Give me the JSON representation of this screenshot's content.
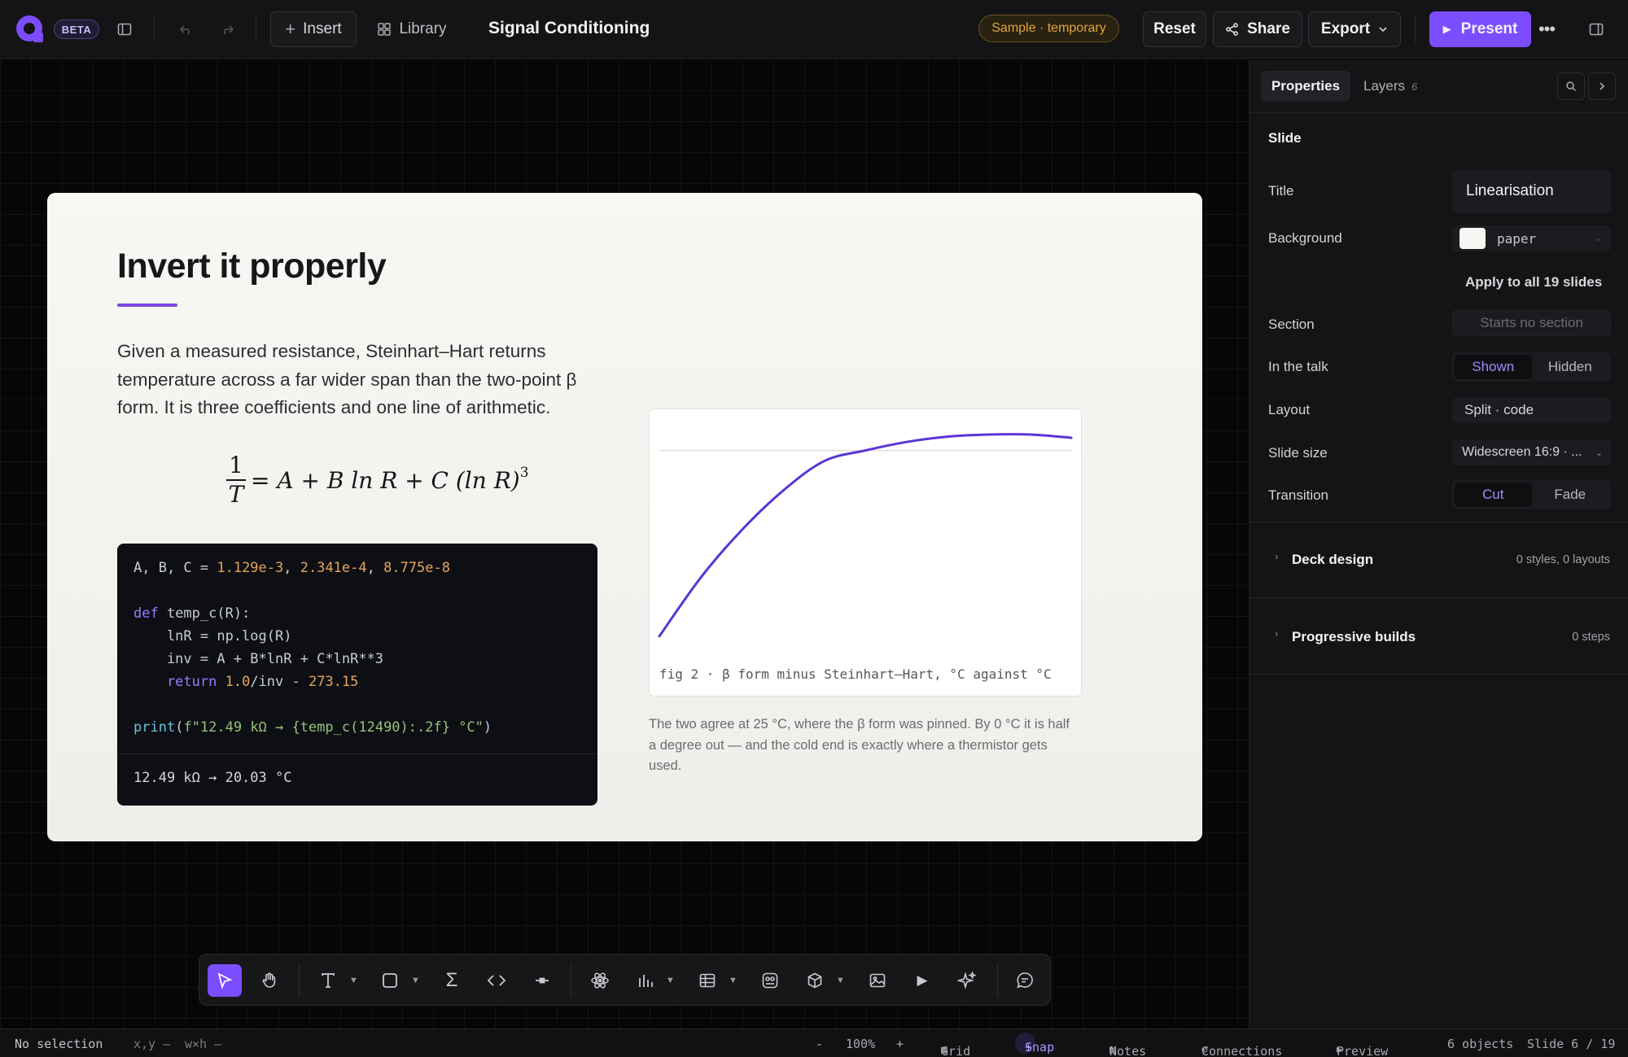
{
  "app": {
    "badge": "BETA",
    "doc_title": "Signal Conditioning",
    "sample_badge": "Sample · temporary"
  },
  "toolbar": {
    "insert": "Insert",
    "library": "Library",
    "reset": "Reset",
    "share": "Share",
    "export": "Export",
    "present": "Present"
  },
  "slide": {
    "title": "Invert it properly",
    "body": "Given a measured resistance, Steinhart–Hart returns temperature across a far wider span than the two-point β form. It is three coefficients and one line of arithmetic.",
    "formula": {
      "lhs_num": "1",
      "lhs_den": "T",
      "rhs": "= A + B ln R + C (ln R)",
      "exp": "3"
    },
    "code": {
      "l1_a": "A, B, C = ",
      "c1": "1.129e-3",
      "sep1": ", ",
      "c2": "2.341e-4",
      "sep2": ", ",
      "c3": "8.775e-8",
      "l2_kw": "def",
      "l2_rest": " temp_c(R):",
      "l3": "    lnR = np.log(R)",
      "l4": "    inv = A + B*lnR + C*lnR**3",
      "l5_kw": "    return",
      "l5_num": " 1.0",
      "l5_mid": "/inv - ",
      "l5_num2": "273.15",
      "l6_fn": "print",
      "l6_p": "(",
      "l6_str": "f\"12.49 kΩ → {temp_c(12490):.2f} °C\"",
      "l6_end": ")",
      "output": "12.49 kΩ → 20.03 °C"
    },
    "fig_caption": "fig 2 · β form minus Steinhart–Hart, °C against °C",
    "chart_desc": "The two agree at 25 °C, where the β form was pinned. By 0 °C it is half a degree out — and the cold end is exactly where a thermistor gets used."
  },
  "chart_data": {
    "type": "line",
    "title": "",
    "xlabel": "",
    "ylabel": "",
    "grid": false,
    "series": [
      {
        "values": [
          -1.75,
          -1.2,
          -0.75,
          -0.38,
          -0.1,
          0.0,
          0.08,
          0.13,
          0.15,
          0.15,
          0.12
        ]
      }
    ],
    "x": [
      0,
      1,
      2,
      3,
      4,
      5,
      6,
      7,
      8,
      9,
      10
    ],
    "reference_line_y": 0,
    "ylim": [
      -1.85,
      0.25
    ],
    "color": "#5b35d6"
  },
  "panel": {
    "tabs": {
      "properties": "Properties",
      "layers": "Layers",
      "layers_count": "6"
    },
    "section_title": "Slide",
    "title_label": "Title",
    "title_value": "Linearisation",
    "bg_label": "Background",
    "bg_value": "paper",
    "bg_swatch": "#f7f6f2",
    "apply_all": "Apply to all 19 slides",
    "section_label": "Section",
    "section_placeholder": "Starts no section",
    "talk_label": "In the talk",
    "talk_shown": "Shown",
    "talk_hidden": "Hidden",
    "layout_label": "Layout",
    "layout_value": "Split · code",
    "size_label": "Slide size",
    "size_value": "Widescreen 16:9 · ...",
    "transition_label": "Transition",
    "trans_cut": "Cut",
    "trans_fade": "Fade",
    "deck_design": "Deck design",
    "deck_design_meta": "0 styles, 0 layouts",
    "builds": "Progressive builds",
    "builds_meta": "0 steps"
  },
  "status": {
    "selection": "No selection",
    "xy": "x,y —",
    "wh": "w×h —",
    "zoom_minus": "-",
    "zoom": "100%",
    "zoom_plus": "+",
    "grid": "Grid",
    "snap": "Snap",
    "notes": "Notes",
    "connections": "Connections",
    "preview": "Preview",
    "objects": "6 objects",
    "slide_pos": "Slide 6 / 19"
  },
  "colors": {
    "accent": "#7c4dff",
    "present_bg": "#7c4dff",
    "sample_badge": "#e5a53a"
  }
}
